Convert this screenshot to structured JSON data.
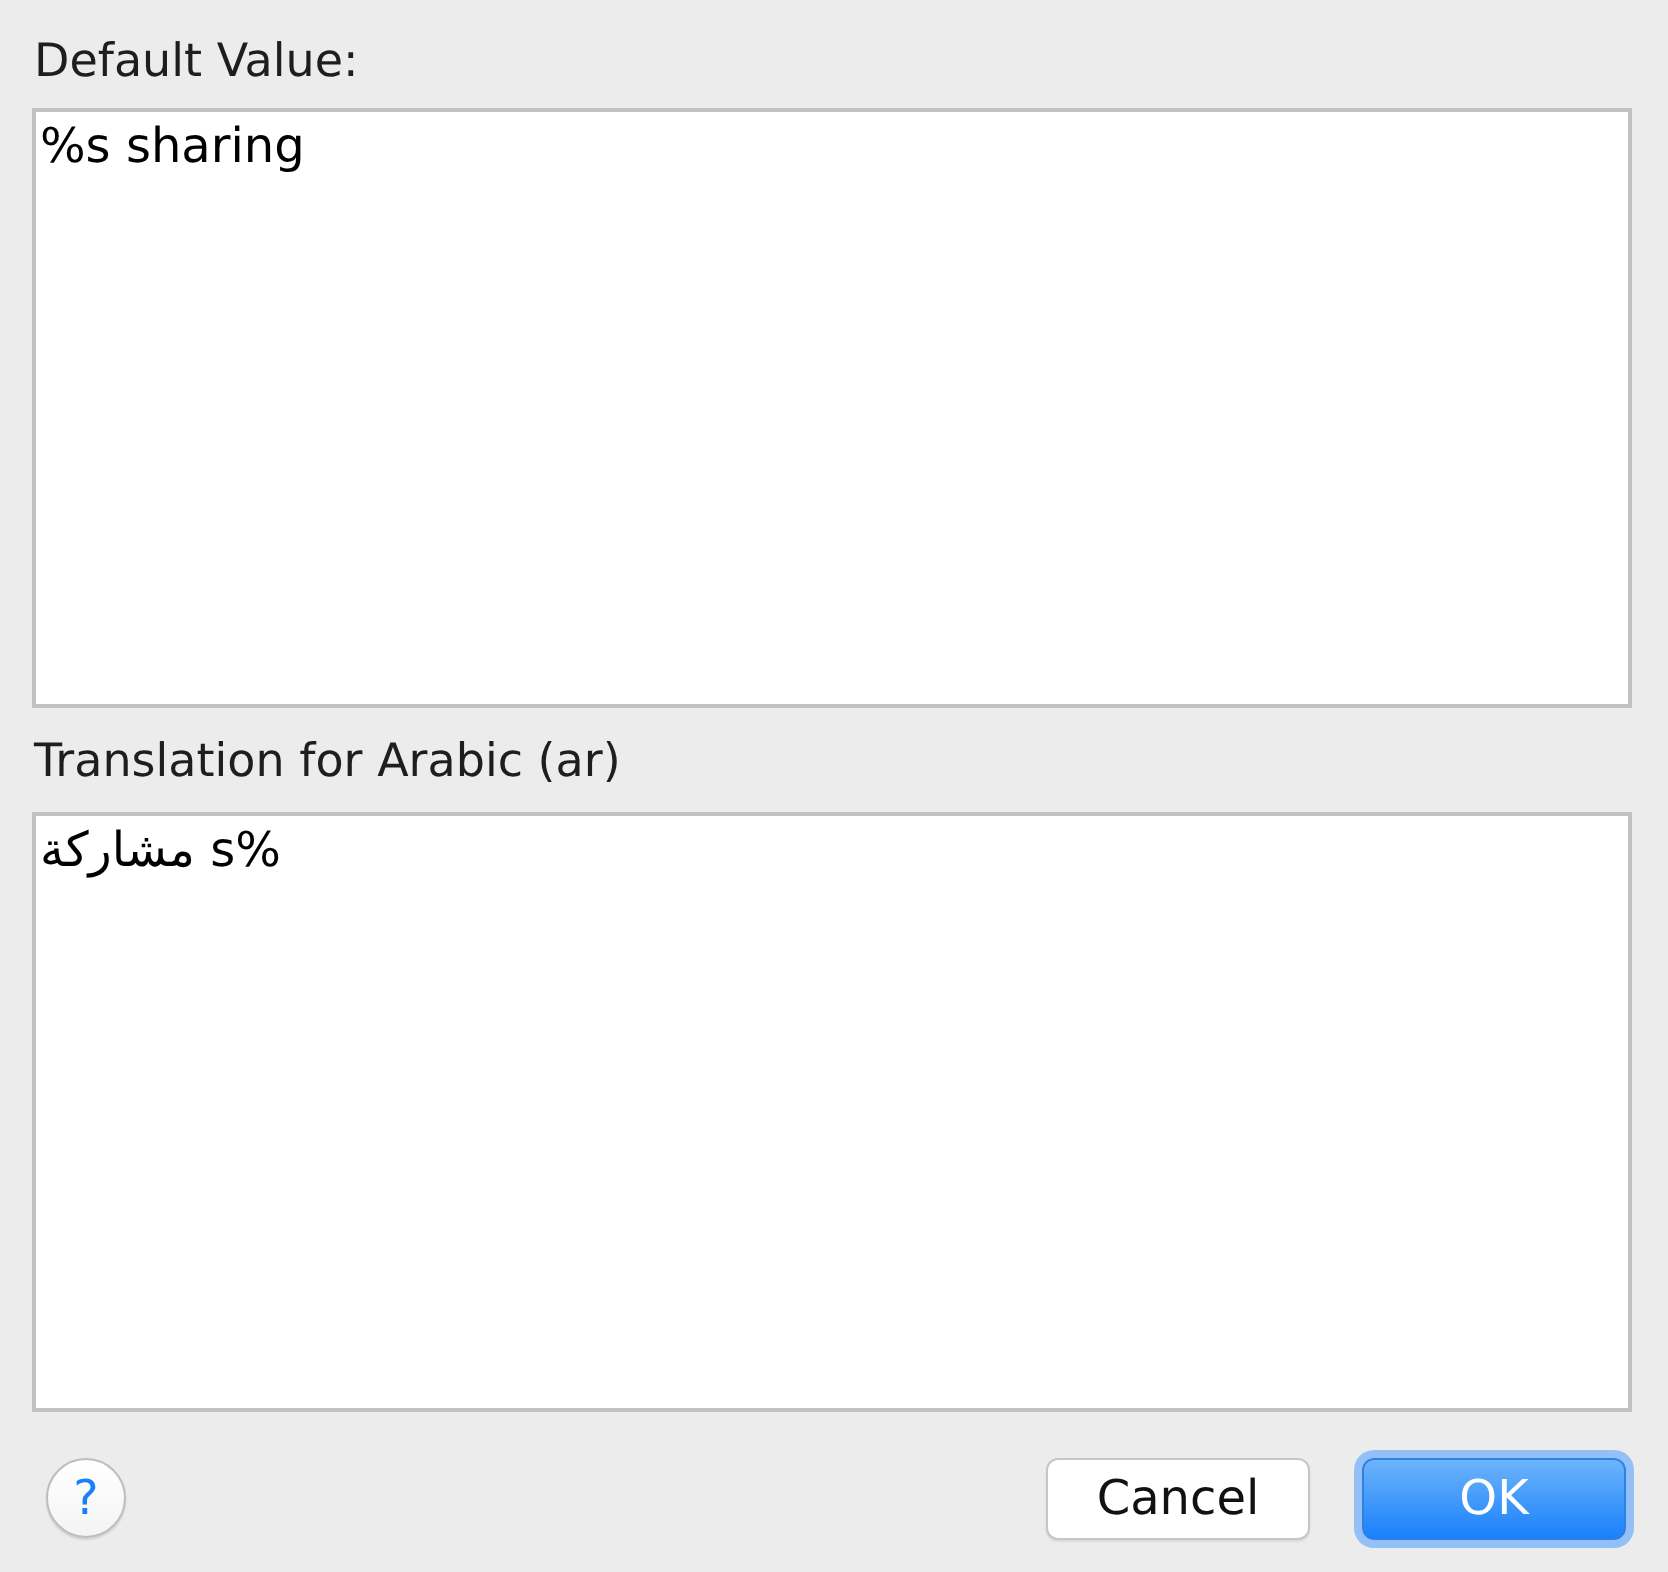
{
  "fields": [
    {
      "label": "Default Value:",
      "value": "%s sharing",
      "rtl": false
    },
    {
      "label": "Translation for Arabic (ar)",
      "value": "%s مشاركة",
      "rtl": true
    }
  ],
  "buttons": [
    {
      "kind": "help",
      "label": "?",
      "focused": false
    },
    {
      "kind": "secondary",
      "label": "Cancel",
      "focused": false
    },
    {
      "kind": "default",
      "label": "OK",
      "focused": true
    }
  ]
}
